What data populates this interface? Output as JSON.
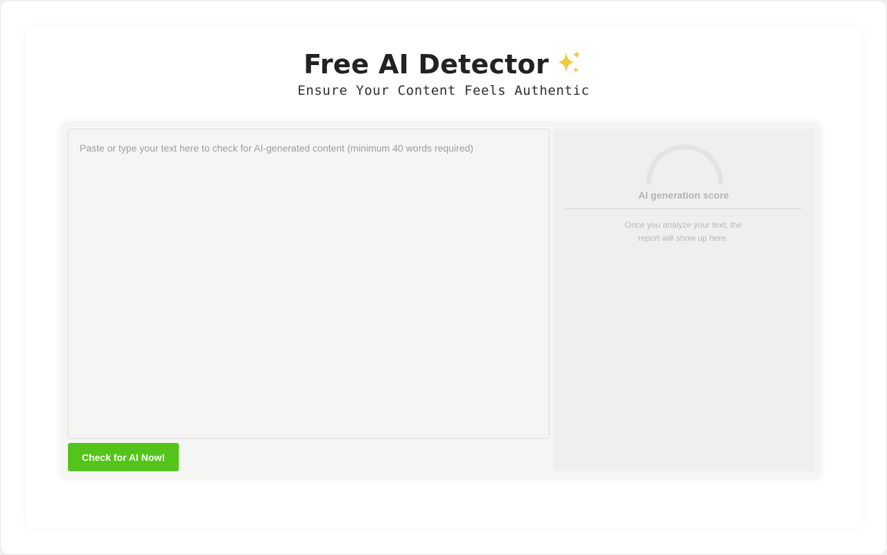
{
  "header": {
    "title": "Free AI Detector",
    "subtitle": "Ensure Your Content Feels Authentic",
    "title_icon": "sparkles-icon"
  },
  "editor": {
    "placeholder": "Paste or type your text here to check for AI-generated content (minimum 40 words required)",
    "value": ""
  },
  "actions": {
    "check_label": "Check for AI Now!"
  },
  "report": {
    "score_label": "AI generation score",
    "empty_message": "Once you analyze your text, the report will show up here."
  },
  "colors": {
    "accent": "#52c41a",
    "sparkle": "#f2c744",
    "panel": "#f5f5f4",
    "report_bg": "#efefef"
  }
}
